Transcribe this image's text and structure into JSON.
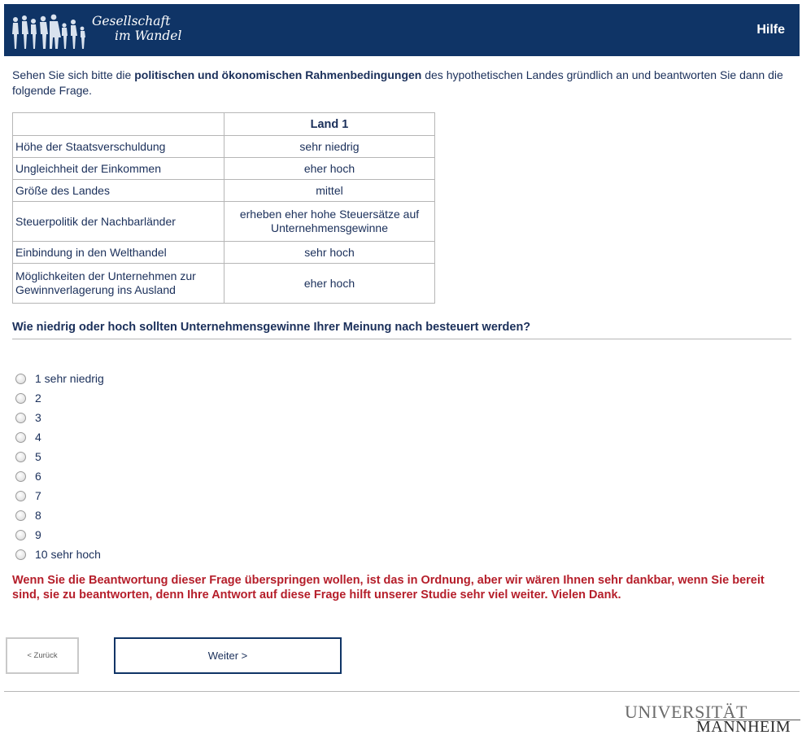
{
  "header": {
    "logo_line1": "Gesellschaft",
    "logo_line2": "im Wandel",
    "help_label": "Hilfe",
    "logo_icon": "people-silhouettes-icon",
    "background_color": "#0f3466"
  },
  "intro": {
    "text_before": "Sehen Sie sich bitte die ",
    "text_bold": "politischen und ökonomischen Rahmenbedingungen",
    "text_after": " des hypothetischen Landes gründlich an und beantworten Sie dann die folgende Frage."
  },
  "table": {
    "column_header": "Land 1",
    "rows": [
      {
        "label": "Höhe der Staatsverschuldung",
        "value": "sehr niedrig"
      },
      {
        "label": "Ungleichheit der Einkommen",
        "value": "eher hoch"
      },
      {
        "label": "Größe des Landes",
        "value": "mittel"
      },
      {
        "label": "Steuerpolitik der Nachbarländer",
        "value": "erheben eher hohe Steuersätze auf Unternehmensgewinne"
      },
      {
        "label": "Einbindung in den Welthandel",
        "value": "sehr hoch"
      },
      {
        "label": "Möglichkeiten der Unternehmen zur Gewinnverlagerung ins Ausland",
        "value": "eher hoch"
      }
    ]
  },
  "question": "Wie niedrig oder hoch sollten Unternehmensgewinne Ihrer Meinung nach besteuert werden?",
  "options": [
    {
      "label": "1 sehr niedrig",
      "selected": false
    },
    {
      "label": "2",
      "selected": false
    },
    {
      "label": "3",
      "selected": false
    },
    {
      "label": "4",
      "selected": false
    },
    {
      "label": "5",
      "selected": false
    },
    {
      "label": "6",
      "selected": false
    },
    {
      "label": "7",
      "selected": false
    },
    {
      "label": "8",
      "selected": false
    },
    {
      "label": "9",
      "selected": false
    },
    {
      "label": "10 sehr hoch",
      "selected": false
    }
  ],
  "note": "Wenn Sie die Beantwortung dieser Frage überspringen wollen, ist das in Ordnung, aber wir wären Ihnen sehr dankbar, wenn Sie bereit sind, sie zu beantworten, denn Ihre Antwort auf diese Frage hilft unserer Studie sehr viel weiter. Vielen Dank.",
  "navigation": {
    "back_label": "< Zurück",
    "next_label": "Weiter >"
  },
  "footer": {
    "university_line1": "UNIVERSITÄT",
    "university_line2": "MANNHEIM"
  },
  "colors": {
    "accent": "#0f3466",
    "text": "#1a2f5a",
    "warning": "#b51e2a"
  }
}
